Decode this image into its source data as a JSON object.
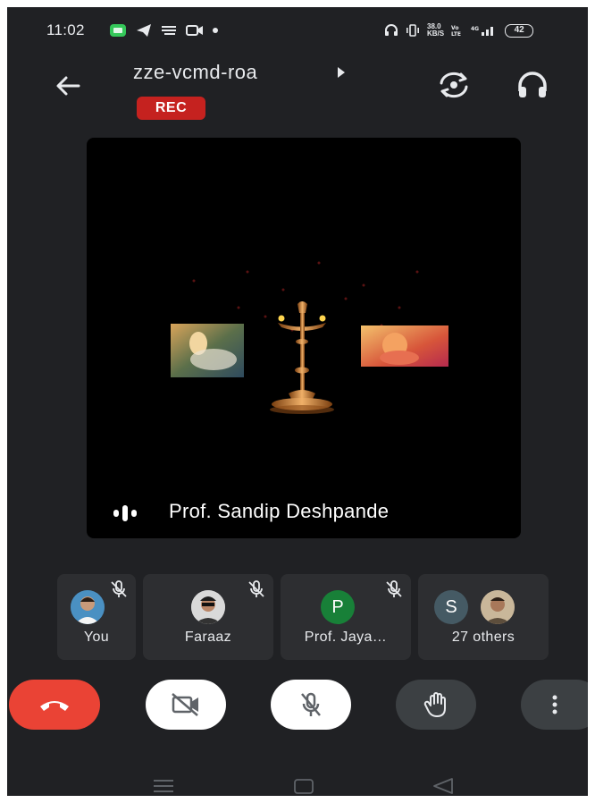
{
  "status_bar": {
    "time": "11:02",
    "net_speed": "38.0",
    "net_unit": "KB/S",
    "battery": "42",
    "icons": [
      "app-notification-icon",
      "telegram-icon",
      "message-icon",
      "video-record-icon",
      "dot-icon",
      "headphones-icon",
      "vibrate-icon",
      "volte-icon",
      "signal-4g-icon",
      "battery-icon"
    ]
  },
  "header": {
    "meeting_code": "zze-vcmd-roa",
    "recording_badge": "REC",
    "icons": [
      "back-arrow-icon",
      "expand-arrow-icon",
      "switch-camera-icon",
      "headphones-audio-icon"
    ]
  },
  "main_tile": {
    "speaker_name": "Prof. Sandip Deshpande",
    "content": "shared video with oil lamp and framed pictures",
    "icons": [
      "speaking-indicator-icon"
    ]
  },
  "participants": [
    {
      "name": "You",
      "muted": true,
      "avatar": "photo"
    },
    {
      "name": "Faraaz",
      "muted": true,
      "avatar": "photo"
    },
    {
      "name": "Prof. Jaya…",
      "muted": true,
      "avatar_letter": "P",
      "avatar_color": "#188038"
    },
    {
      "name": "27 others",
      "muted": false,
      "avatar_letter": "S",
      "avatar_color": "#455a64"
    }
  ],
  "controls": {
    "icons": [
      "end-call-icon",
      "camera-off-icon",
      "mic-off-icon",
      "raise-hand-icon",
      "more-vert-icon"
    ],
    "end_call_color": "#ea4335"
  },
  "nav_bar": {
    "icons": [
      "recents-icon",
      "home-icon",
      "back-triangle-icon"
    ]
  },
  "colors": {
    "background": "#202124",
    "tile": "#2d2e31",
    "text": "#e8eaed",
    "rec": "#c5221f"
  }
}
